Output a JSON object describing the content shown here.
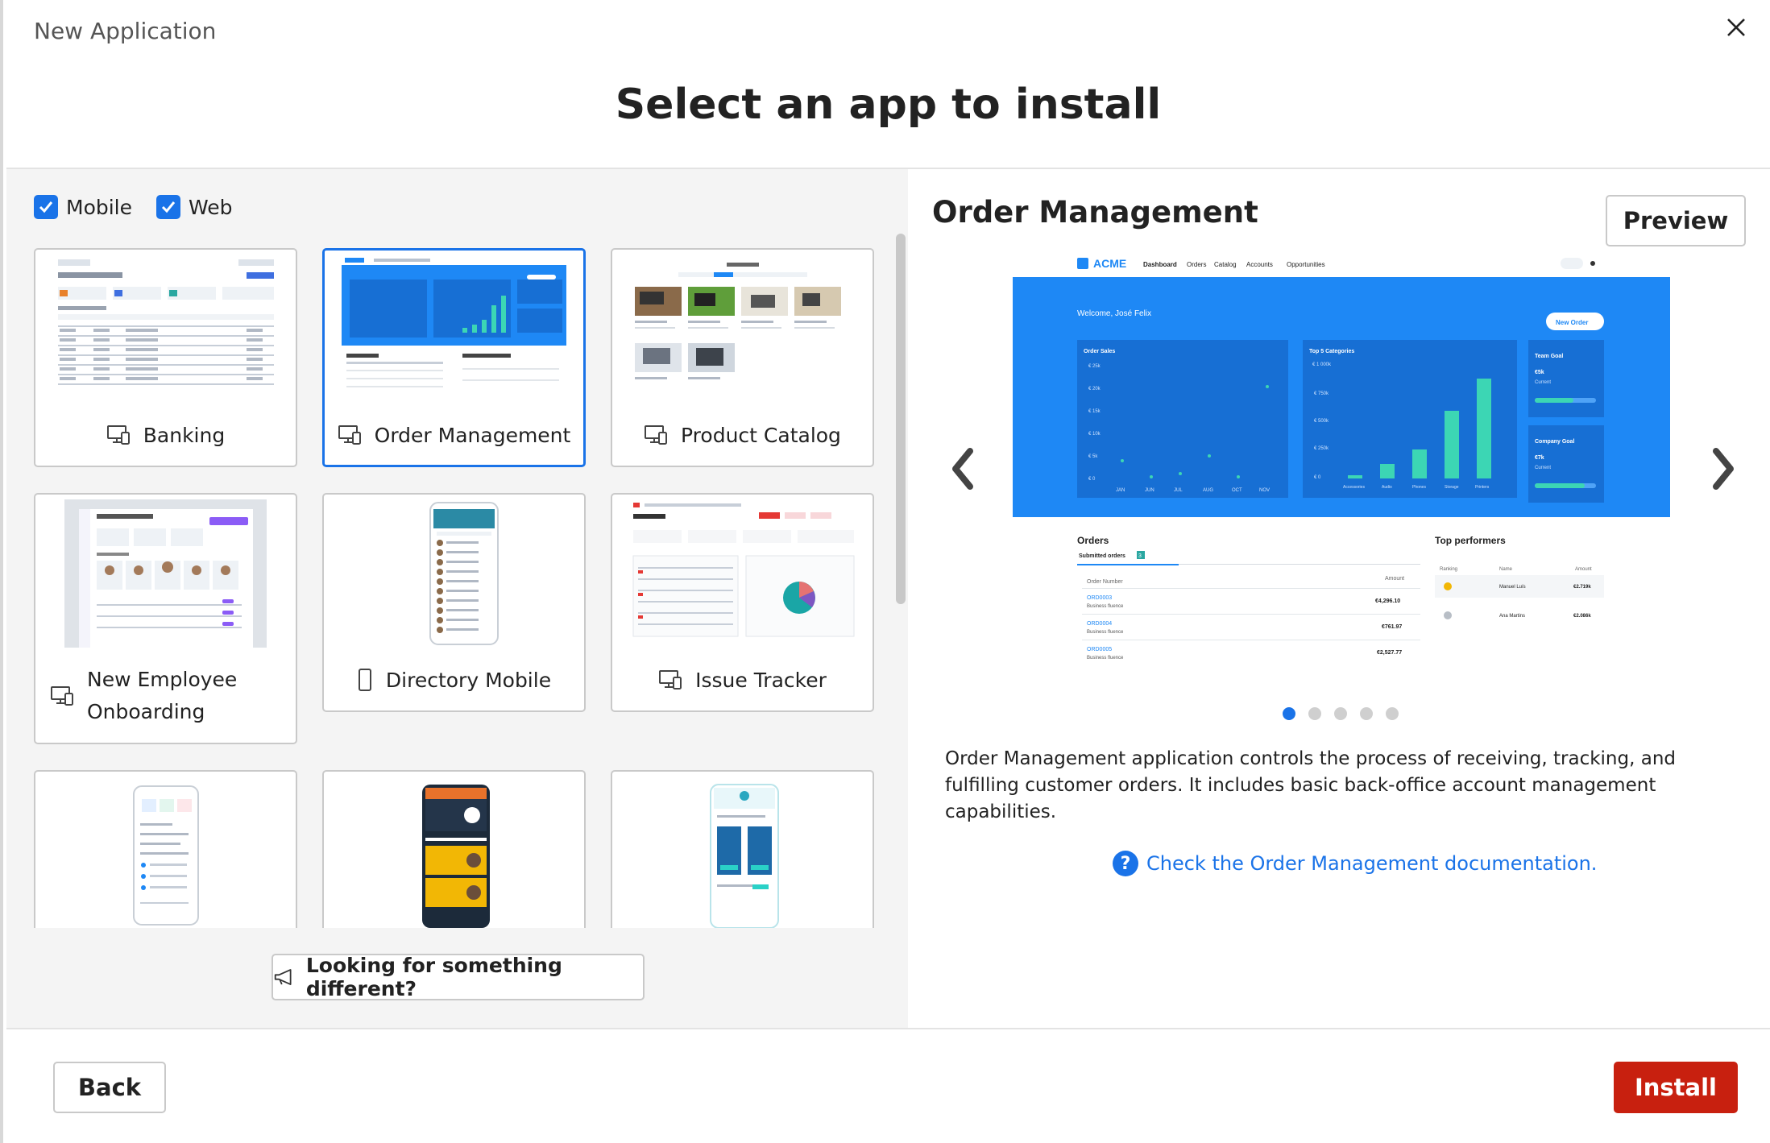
{
  "dialog": {
    "title": "New Application",
    "close_icon": "close-icon"
  },
  "heading": "Select an app to install",
  "filters": [
    {
      "label": "Mobile",
      "checked": true
    },
    {
      "label": "Web",
      "checked": true
    }
  ],
  "apps": [
    {
      "name": "Banking",
      "icon": "desktop-mobile-icon",
      "selected": false
    },
    {
      "name": "Order Management",
      "icon": "desktop-mobile-icon",
      "selected": true
    },
    {
      "name": "Product Catalog",
      "icon": "desktop-mobile-icon",
      "selected": false
    },
    {
      "name": "New Employee Onboarding",
      "line1": "New Employee",
      "line2": "Onboarding",
      "icon": "desktop-mobile-icon",
      "selected": false
    },
    {
      "name": "Directory Mobile",
      "icon": "mobile-icon",
      "selected": false
    },
    {
      "name": "Issue Tracker",
      "icon": "desktop-mobile-icon",
      "selected": false
    }
  ],
  "looking": {
    "label": "Looking for something different?",
    "icon": "megaphone-icon"
  },
  "detail": {
    "title": "Order Management",
    "preview_label": "Preview",
    "description": "Order Management application controls the process of receiving, tracking, and fulfilling customer orders. It includes basic back-office account management capabilities.",
    "doc_link": "Check the Order Management documentation.",
    "help_glyph": "?",
    "carousel_count": 5,
    "carousel_active": 0,
    "screenshot": {
      "brand": "ACME",
      "nav": [
        "Dashboard",
        "Orders",
        "Catalog",
        "Accounts",
        "Opportunities"
      ],
      "welcome": "Welcome, José Felix",
      "new_order": "New Order",
      "order_sales": "Order Sales",
      "top_categories": "Top 5 Categories",
      "team_goal": "Team Goal",
      "team_goal_value": "€5k",
      "team_goal_sub": "Current",
      "company_goal": "Company Goal",
      "company_goal_value": "€7k",
      "company_goal_sub": "Current",
      "sales_yticks": [
        "€ 25k",
        "€ 20k",
        "€ 15k",
        "€ 10k",
        "€ 5k",
        "€ 0"
      ],
      "sales_months": [
        "JAN",
        "JUN",
        "JUL",
        "AUG",
        "OCT",
        "NOV"
      ],
      "cat_yticks": [
        "€ 1 000k",
        "€ 750k",
        "€ 500k",
        "€ 250k",
        "€ 0"
      ],
      "categories": [
        "Accessories",
        "Audio",
        "Phones",
        "Storage",
        "Printers"
      ],
      "orders_title": "Orders",
      "orders_tab": "Submitted orders",
      "orders_tab_count": "3",
      "orders_col1": "Order Number",
      "orders_col2": "Amount",
      "orders": [
        {
          "id": "ORD0003",
          "sub": "Business fluence",
          "amount": "€4,296.10"
        },
        {
          "id": "ORD0004",
          "sub": "Business fluence",
          "amount": "€761.97"
        },
        {
          "id": "ORD0005",
          "sub": "Business fluence",
          "amount": "€2,527.77"
        }
      ],
      "top_title": "Top performers",
      "top_cols": [
        "Ranking",
        "Name",
        "Amount"
      ],
      "performers": [
        {
          "name": "Manuel Luís",
          "amount": "€2.719k"
        },
        {
          "name": "Ana Martins",
          "amount": "€2.086k"
        }
      ]
    }
  },
  "footer": {
    "back_label": "Back",
    "install_label": "Install"
  },
  "colors": {
    "accent": "#1a73e8",
    "install": "#c8200f",
    "preview_blue": "#1e88f5"
  }
}
